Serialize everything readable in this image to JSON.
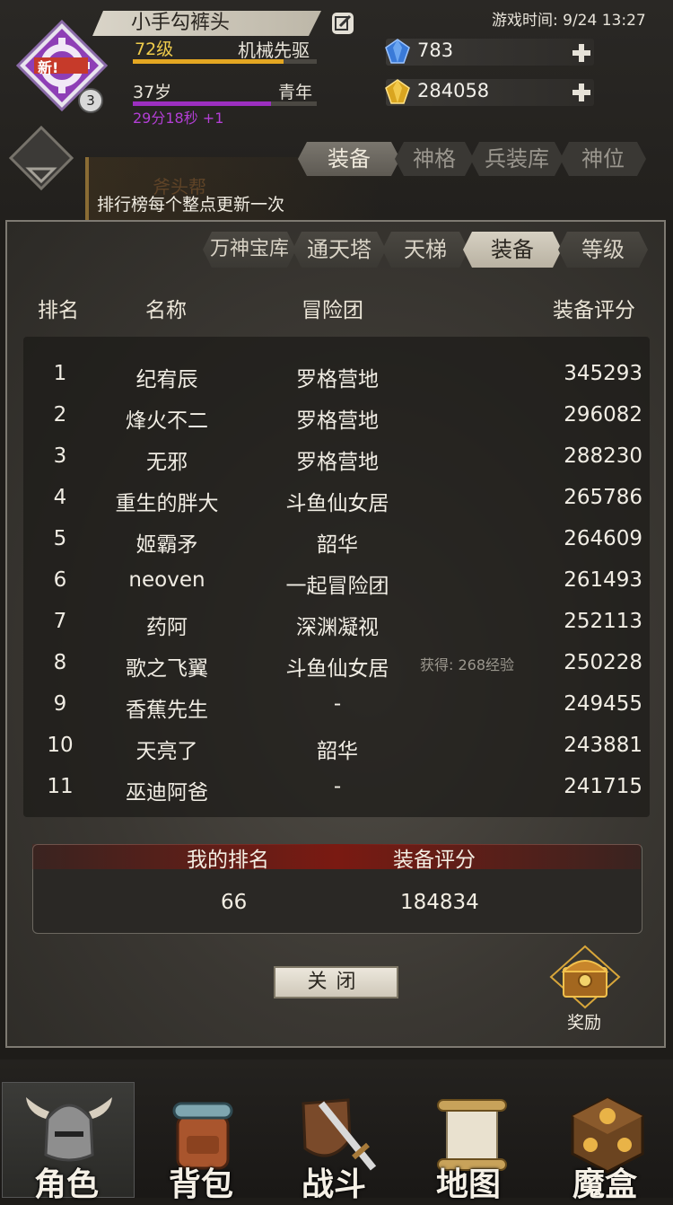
{
  "header": {
    "name": "小手勾裤头",
    "level": "72级",
    "class": "机械先驱",
    "level_progress": 0.82,
    "age": "37岁",
    "stage": "青年",
    "age_progress": 0.75,
    "timer": "29分18秒 +1",
    "avatar_badge": "新!",
    "avatar_count": "3",
    "game_time": "游戏时间: 9/24 13:27",
    "diamond": "783",
    "gold": "284058",
    "notice": "排行榜每个整点更新一次",
    "banner_ghost": "斧头帮"
  },
  "top_tabs": [
    "装备",
    "神格",
    "兵装库",
    "神位"
  ],
  "rank_tabs": [
    "万神宝库",
    "通天塔",
    "天梯",
    "装备",
    "等级"
  ],
  "columns": {
    "rank": "排名",
    "name": "名称",
    "guild": "冒险团",
    "score": "装备评分"
  },
  "rows": [
    {
      "rank": "1",
      "name": "纪宥辰",
      "guild": "罗格营地",
      "score": "345293"
    },
    {
      "rank": "2",
      "name": "烽火不二",
      "guild": "罗格营地",
      "score": "296082"
    },
    {
      "rank": "3",
      "name": "无邪",
      "guild": "罗格营地",
      "score": "288230"
    },
    {
      "rank": "4",
      "name": "重生的胖大",
      "guild": "斗鱼仙女居",
      "score": "265786"
    },
    {
      "rank": "5",
      "name": "姬霸矛",
      "guild": "韶华",
      "score": "264609"
    },
    {
      "rank": "6",
      "name": "neoven",
      "guild": "一起冒险团",
      "score": "261493"
    },
    {
      "rank": "7",
      "name": "药阿",
      "guild": "深渊凝视",
      "score": "252113"
    },
    {
      "rank": "8",
      "name": "歌之飞翼",
      "guild": "斗鱼仙女居",
      "score": "250228"
    },
    {
      "rank": "9",
      "name": "香蕉先生",
      "guild": "-",
      "score": "249455"
    },
    {
      "rank": "10",
      "name": "天亮了",
      "guild": "韶华",
      "score": "243881"
    },
    {
      "rank": "11",
      "name": "巫迪阿爸",
      "guild": "-",
      "score": "241715"
    }
  ],
  "exp_hint": "获得: 268经验",
  "my_rank": {
    "rank_label": "我的排名",
    "score_label": "装备评分",
    "rank": "66",
    "score": "184834"
  },
  "close_label": "关闭",
  "reward_label": "奖励",
  "bottom_nav": [
    "角色",
    "背包",
    "战斗",
    "地图",
    "魔盒"
  ],
  "colors": {
    "accent_gold": "#e4a722",
    "accent_purple": "#9c2fc0",
    "panel_border": "#7e7a72",
    "my_rank_header": "#7a1a12"
  }
}
